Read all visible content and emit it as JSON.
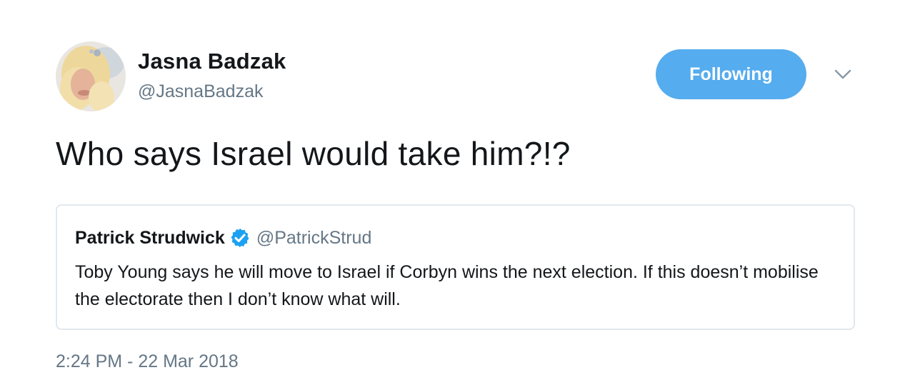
{
  "author": {
    "name": "Jasna Badzak",
    "handle": "@JasnaBadzak"
  },
  "follow_button": {
    "label": "Following"
  },
  "menu": {
    "icon": "chevron-down-icon"
  },
  "tweet": {
    "text": "Who says Israel would take him?!?",
    "timestamp": "2:24 PM - 22 Mar 2018"
  },
  "quoted_tweet": {
    "name": "Patrick Strudwick",
    "verified_icon": "verified-badge-icon",
    "handle": "@PatrickStrud",
    "text": "Toby Young says he will move to Israel if Corbyn wins the next election. If this doesn’t mobilise the electorate then I don’t know what will."
  },
  "colors": {
    "accent": "#55acee",
    "verified": "#1da1f2",
    "secondary_text": "#657786",
    "border": "#e1e8ed"
  }
}
